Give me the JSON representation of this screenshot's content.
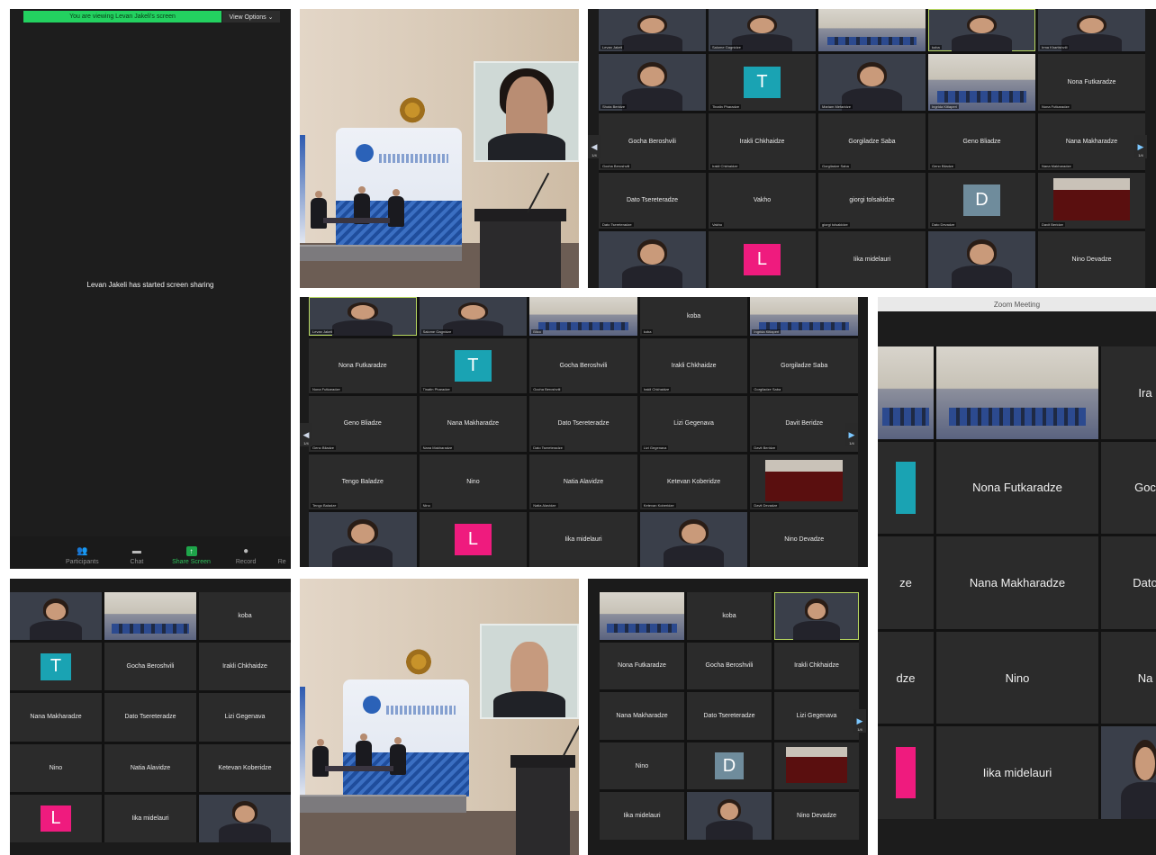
{
  "screen_share_panel": {
    "banner": "You are viewing Levan Jakeli's screen",
    "view_options": "View Options ⌄",
    "message": "Levan Jakeli has started screen sharing",
    "toolbar": [
      {
        "icon": "participants-icon",
        "glyph": "👥",
        "label": "Participants",
        "extra": "61 ^"
      },
      {
        "icon": "chat-icon",
        "glyph": "▬",
        "label": "Chat"
      },
      {
        "icon": "share-screen-icon",
        "glyph": "↑",
        "label": "Share Screen"
      },
      {
        "icon": "record-icon",
        "glyph": "●",
        "label": "Record"
      },
      {
        "icon": "reactions-icon",
        "glyph": "",
        "label": "Re"
      }
    ]
  },
  "zoom_grid_a": {
    "page_left": "1/4",
    "page_right": "1/4",
    "tiles": [
      {
        "name": "",
        "caption": "Levan Jakeli",
        "kind": "video"
      },
      {
        "name": "",
        "caption": "Salome Gagnidze",
        "kind": "video"
      },
      {
        "name": "",
        "caption": "",
        "kind": "room"
      },
      {
        "name": "",
        "caption": "koba",
        "kind": "video",
        "highlight": true
      },
      {
        "name": "",
        "caption": "Irma Khartishvili",
        "kind": "video"
      },
      {
        "name": "",
        "caption": "Shota Beridze",
        "kind": "video"
      },
      {
        "name": "T",
        "caption": "Tinatin Pharadze",
        "kind": "avatar",
        "color": "#1aa3b3"
      },
      {
        "name": "",
        "caption": "Mariam Mefaridze",
        "kind": "video"
      },
      {
        "name": "",
        "caption": "Ingrida Kitiaperi",
        "kind": "room"
      },
      {
        "name": "Nona Futkaradze",
        "caption": "Nona Futkaradze",
        "kind": "name"
      },
      {
        "name": "Gocha Beroshvili",
        "caption": "Gocha Beroshvili",
        "kind": "name"
      },
      {
        "name": "Irakli Chkhaidze",
        "caption": "Irakli Chkhaidze",
        "kind": "name"
      },
      {
        "name": "Gorgiladze Saba",
        "caption": "Gorgiladze Saba",
        "kind": "name"
      },
      {
        "name": "Geno Bliadze",
        "caption": "Geno Bliadze",
        "kind": "name"
      },
      {
        "name": "Nana Makharadze",
        "caption": "Nana Makharadze",
        "kind": "name"
      },
      {
        "name": "Dato Tsereteradze",
        "caption": "Dato Tsereteradze",
        "kind": "name"
      },
      {
        "name": "Vakho",
        "caption": "Vakho",
        "kind": "name"
      },
      {
        "name": "giorgi tolsakidze",
        "caption": "giorgi tolsakidze",
        "kind": "name"
      },
      {
        "name": "D",
        "caption": "Dato Devadze",
        "kind": "avatar",
        "color": "#6f8c9c"
      },
      {
        "name": "",
        "caption": "Davit Beridze",
        "kind": "dark"
      },
      {
        "name": "",
        "caption": "",
        "kind": "video"
      },
      {
        "name": "L",
        "caption": "",
        "kind": "avatar",
        "color": "#ef1b7e"
      },
      {
        "name": "Iika midelauri",
        "caption": "",
        "kind": "name"
      },
      {
        "name": "",
        "caption": "",
        "kind": "video"
      },
      {
        "name": "Nino Devadze",
        "caption": "",
        "kind": "name"
      }
    ]
  },
  "zoom_grid_b": {
    "page_left": "1/4",
    "page_right": "1/4",
    "tiles": [
      {
        "name": "",
        "caption": "Levan Jakeli",
        "kind": "video",
        "highlight": true
      },
      {
        "name": "",
        "caption": "Salome Gagnidze",
        "kind": "video"
      },
      {
        "name": "",
        "caption": "Blico",
        "kind": "room"
      },
      {
        "name": "koba",
        "caption": "koba",
        "kind": "name"
      },
      {
        "name": "",
        "caption": "Ingrida Kitiaperi",
        "kind": "room"
      },
      {
        "name": "Nona Futkaradze",
        "caption": "Nona Futkaradze",
        "kind": "name"
      },
      {
        "name": "T",
        "caption": "Tinatin Pharadze",
        "kind": "avatar",
        "color": "#1aa3b3"
      },
      {
        "name": "Gocha Beroshvili",
        "caption": "Gocha Beroshvili",
        "kind": "name"
      },
      {
        "name": "Irakli Chkhaidze",
        "caption": "Irakli Chkhaidze",
        "kind": "name"
      },
      {
        "name": "Gorgiladze Saba",
        "caption": "Gorgiladze Saba",
        "kind": "name"
      },
      {
        "name": "Geno Bliadze",
        "caption": "Geno Bliadze",
        "kind": "name"
      },
      {
        "name": "Nana Makharadze",
        "caption": "Nana Makharadze",
        "kind": "name"
      },
      {
        "name": "Dato Tsereteradze",
        "caption": "Dato Tsereteradze",
        "kind": "name"
      },
      {
        "name": "Lizi Gegenava",
        "caption": "Lizi Gegenava",
        "kind": "name"
      },
      {
        "name": "Davit Beridze",
        "caption": "Davit Beridze",
        "kind": "name"
      },
      {
        "name": "Tengo Baladze",
        "caption": "Tengo Baladze",
        "kind": "name"
      },
      {
        "name": "Nino",
        "caption": "Nino",
        "kind": "name"
      },
      {
        "name": "Natia Alavidze",
        "caption": "Natia Alavidze",
        "kind": "name"
      },
      {
        "name": "Ketevan Koberidze",
        "caption": "Ketevan Koberidze",
        "kind": "name"
      },
      {
        "name": "",
        "caption": "Davit Devadze",
        "kind": "dark"
      },
      {
        "name": "",
        "caption": "",
        "kind": "video"
      },
      {
        "name": "L",
        "caption": "",
        "kind": "avatar",
        "color": "#ef1b7e"
      },
      {
        "name": "Iika midelauri",
        "caption": "",
        "kind": "name"
      },
      {
        "name": "",
        "caption": "",
        "kind": "video"
      },
      {
        "name": "Nino Devadze",
        "caption": "",
        "kind": "name"
      }
    ]
  },
  "zoom_window": {
    "title": "Zoom Meeting",
    "tiles": [
      {
        "name": "",
        "kind": "room"
      },
      {
        "name": "",
        "kind": "room"
      },
      {
        "name": "Ira",
        "kind": "name"
      },
      {
        "name": "",
        "kind": "avatar",
        "color": "#1aa3b3"
      },
      {
        "name": "Nona Futkaradze",
        "kind": "name"
      },
      {
        "name": "Goc",
        "kind": "name"
      },
      {
        "name": "ze",
        "kind": "name"
      },
      {
        "name": "Nana Makharadze",
        "kind": "name"
      },
      {
        "name": "Dato",
        "kind": "name"
      },
      {
        "name": "dze",
        "kind": "name"
      },
      {
        "name": "Nino",
        "kind": "name"
      },
      {
        "name": "Na",
        "kind": "name"
      },
      {
        "name": "",
        "kind": "avatar",
        "color": "#ef1b7e"
      },
      {
        "name": "Iika midelauri",
        "kind": "name"
      },
      {
        "name": "",
        "kind": "video"
      }
    ]
  },
  "zoom_grid_c": {
    "tiles": [
      {
        "name": "",
        "caption": "",
        "kind": "video"
      },
      {
        "name": "",
        "caption": "",
        "kind": "room"
      },
      {
        "name": "koba",
        "caption": "",
        "kind": "name"
      },
      {
        "name": "T",
        "caption": "",
        "kind": "avatar",
        "color": "#1aa3b3"
      },
      {
        "name": "Gocha Beroshvili",
        "caption": "",
        "kind": "name"
      },
      {
        "name": "Irakli Chkhaidze",
        "caption": "",
        "kind": "name"
      },
      {
        "name": "Nana Makharadze",
        "caption": "",
        "kind": "name"
      },
      {
        "name": "Dato Tsereteradze",
        "caption": "",
        "kind": "name"
      },
      {
        "name": "Lizi Gegenava",
        "caption": "",
        "kind": "name"
      },
      {
        "name": "Nino",
        "caption": "",
        "kind": "name"
      },
      {
        "name": "Natia Alavidze",
        "caption": "",
        "kind": "name"
      },
      {
        "name": "Ketevan Koberidze",
        "caption": "",
        "kind": "name"
      },
      {
        "name": "L",
        "caption": "",
        "kind": "avatar",
        "color": "#ef1b7e"
      },
      {
        "name": "Iika midelauri",
        "caption": "",
        "kind": "name"
      },
      {
        "name": "",
        "caption": "",
        "kind": "video"
      }
    ]
  },
  "zoom_grid_d": {
    "page_right": "1/4",
    "tiles": [
      {
        "name": "",
        "caption": "",
        "kind": "room"
      },
      {
        "name": "koba",
        "caption": "",
        "kind": "name"
      },
      {
        "name": "",
        "caption": "",
        "kind": "video",
        "highlight": true
      },
      {
        "name": "Nona Futkaradze",
        "caption": "",
        "kind": "name"
      },
      {
        "name": "Gocha Beroshvili",
        "caption": "",
        "kind": "name"
      },
      {
        "name": "Irakli Chkhaidze",
        "caption": "",
        "kind": "name"
      },
      {
        "name": "Nana Makharadze",
        "caption": "",
        "kind": "name"
      },
      {
        "name": "Dato Tsereteradze",
        "caption": "",
        "kind": "name"
      },
      {
        "name": "Lizi Gegenava",
        "caption": "",
        "kind": "name"
      },
      {
        "name": "Nino",
        "caption": "",
        "kind": "name"
      },
      {
        "name": "D",
        "caption": "",
        "kind": "avatar",
        "color": "#6f8c9c"
      },
      {
        "name": "",
        "caption": "",
        "kind": "dark"
      },
      {
        "name": "Iika midelauri",
        "caption": "",
        "kind": "name"
      },
      {
        "name": "",
        "caption": "",
        "kind": "video"
      },
      {
        "name": "Nino Devadze",
        "caption": "",
        "kind": "name"
      }
    ]
  },
  "colors": {
    "zoom_green": "#23d160",
    "tile_bg": "#2b2b2b",
    "speaker_highlight": "#b8d860",
    "avatar_teal": "#1aa3b3",
    "avatar_pink": "#ef1b7e",
    "avatar_slate": "#6f8c9c"
  }
}
